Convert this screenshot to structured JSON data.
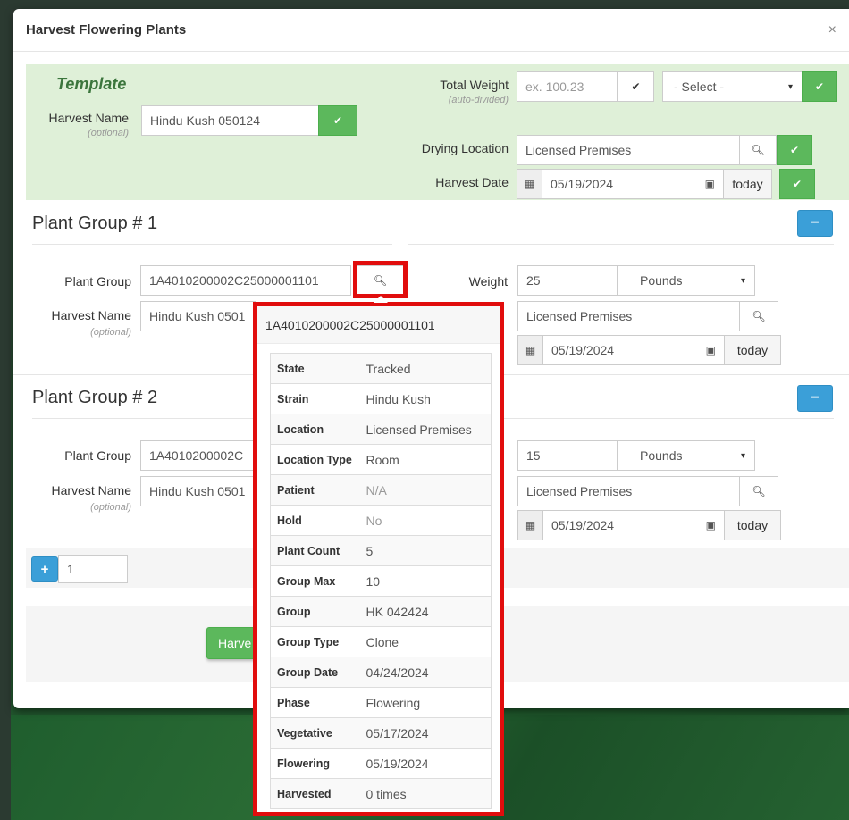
{
  "modal": {
    "title": "Harvest Flowering Plants",
    "close": "×"
  },
  "template": {
    "title": "Template",
    "harvest_name_label": "Harvest Name",
    "optional": "(optional)",
    "harvest_name_value": "Hindu Kush 050124",
    "total_weight_label": "Total Weight",
    "auto_divided": "(auto-divided)",
    "total_weight_placeholder": "ex. 100.23",
    "unit_select": "- Select -",
    "drying_location_label": "Drying Location",
    "drying_location_value": "Licensed Premises",
    "harvest_date_label": "Harvest Date",
    "harvest_date_value": "05/19/2024",
    "today": "today"
  },
  "groups": [
    {
      "title": "Plant Group # 1",
      "plant_group_label": "Plant Group",
      "plant_group_value": "1A4010200002C25000001101",
      "harvest_name_label": "Harvest Name",
      "harvest_name_value": "Hindu Kush 0501",
      "optional": "(optional)",
      "weight_label": "Weight",
      "weight_value": "25",
      "unit": "Pounds",
      "drying_location_value": "Licensed Premises",
      "harvest_date_value": "05/19/2024",
      "today": "today"
    },
    {
      "title": "Plant Group # 2",
      "plant_group_label": "Plant Group",
      "plant_group_value": "1A4010200002C",
      "harvest_name_label": "Harvest Name",
      "harvest_name_value": "Hindu Kush 0501",
      "optional": "(optional)",
      "weight_value": "15",
      "unit": "Pounds",
      "drying_location_value": "Licensed Premises",
      "harvest_date_value": "05/19/2024",
      "today": "today"
    }
  ],
  "add_row": {
    "count": "1"
  },
  "footer": {
    "harvest_button": "Harve"
  },
  "popover": {
    "title": "1A4010200002C25000001101",
    "rows": [
      {
        "k": "State",
        "v": "Tracked"
      },
      {
        "k": "Strain",
        "v": "Hindu Kush"
      },
      {
        "k": "Location",
        "v": "Licensed Premises"
      },
      {
        "k": "Location Type",
        "v": "Room"
      },
      {
        "k": "Patient",
        "v": "N/A"
      },
      {
        "k": "Hold",
        "v": "No"
      },
      {
        "k": "Plant Count",
        "v": "5"
      },
      {
        "k": "Group Max",
        "v": "10"
      },
      {
        "k": "Group",
        "v": "HK 042424"
      },
      {
        "k": "Group Type",
        "v": "Clone"
      },
      {
        "k": "Group Date",
        "v": "04/24/2024"
      },
      {
        "k": "Phase",
        "v": "Flowering"
      },
      {
        "k": "Vegetative",
        "v": "05/17/2024"
      },
      {
        "k": "Flowering",
        "v": "05/19/2024"
      },
      {
        "k": "Harvested",
        "v": "0 times"
      }
    ]
  },
  "icons": {
    "check": "✔",
    "search": "🔍",
    "calendar": "▦",
    "minus": "−",
    "plus": "+",
    "chevron": "⌄"
  },
  "colors": {
    "success": "#5cb85c",
    "template_bg": "#dff0d8",
    "template_title": "#3c763d",
    "primary": "#3b9fd8",
    "highlight": "#e10d0d"
  }
}
